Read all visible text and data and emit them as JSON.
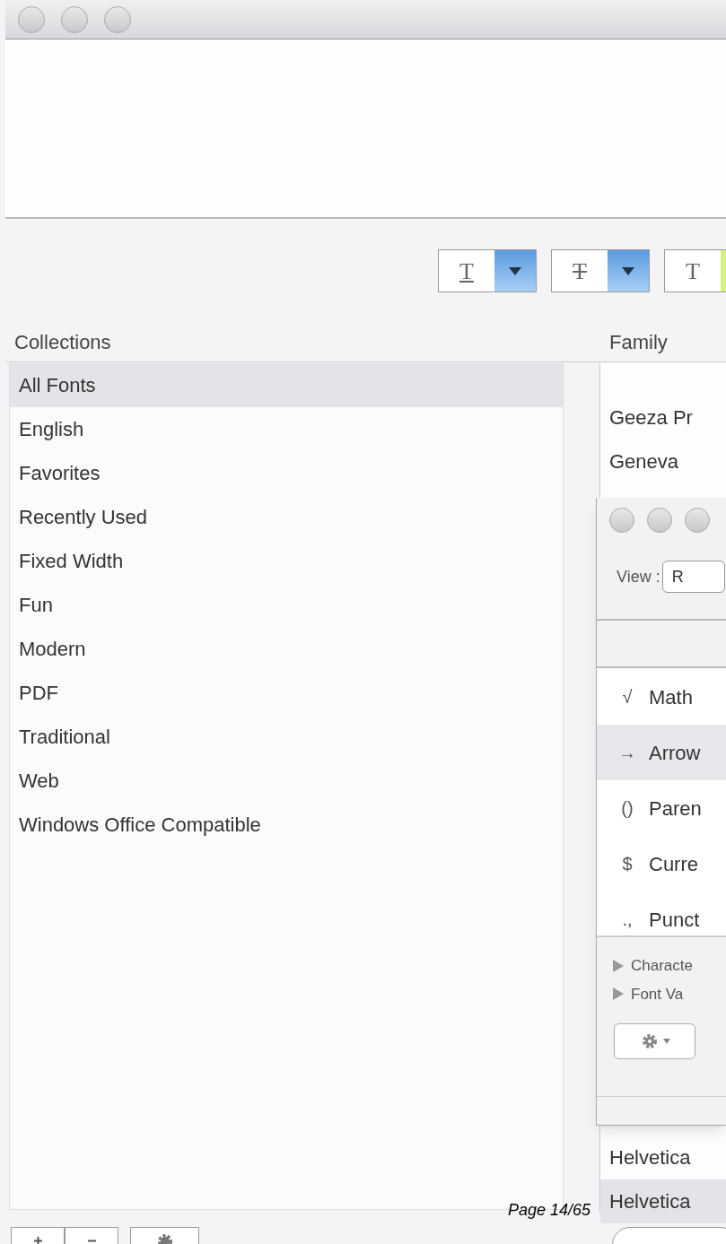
{
  "toolbar": {
    "buttons": [
      {
        "kind": "underline",
        "glyph": "T"
      },
      {
        "kind": "strike",
        "glyph": "T"
      },
      {
        "kind": "color",
        "glyph": "T"
      }
    ]
  },
  "collections": {
    "header": "Collections",
    "items": [
      {
        "label": "All Fonts",
        "selected": true
      },
      {
        "label": "English",
        "selected": false
      },
      {
        "label": "Favorites",
        "selected": false
      },
      {
        "label": "Recently Used",
        "selected": false
      },
      {
        "label": "Fixed Width",
        "selected": false
      },
      {
        "label": "Fun",
        "selected": false
      },
      {
        "label": "Modern",
        "selected": false
      },
      {
        "label": "PDF",
        "selected": false
      },
      {
        "label": "Traditional",
        "selected": false
      },
      {
        "label": "Web",
        "selected": false
      },
      {
        "label": "Windows Office Compatible",
        "selected": false
      }
    ]
  },
  "family": {
    "header": "Family",
    "items_top": [
      {
        "label": "Geeza Pr",
        "selected": false
      },
      {
        "label": "Geneva",
        "selected": false
      }
    ],
    "items_bottom": [
      {
        "label": "Helvetica",
        "selected": false
      },
      {
        "label": "Helvetica",
        "selected": true
      }
    ]
  },
  "character_palette": {
    "view_label": "View :",
    "view_value": "R",
    "items": [
      {
        "symbol": "√",
        "label": "Math",
        "selected": false
      },
      {
        "symbol": "→",
        "label": "Arrow",
        "selected": true
      },
      {
        "symbol": "()",
        "label": "Paren",
        "selected": false
      },
      {
        "symbol": "$",
        "label": "Curre",
        "selected": false
      },
      {
        "symbol": ".,",
        "label": "Punct",
        "selected": false
      }
    ],
    "disclosures": [
      {
        "label": "Characte",
        "expanded": false
      },
      {
        "label": "Font Va",
        "expanded": false
      }
    ]
  },
  "bottom_buttons": [
    {
      "kind": "plus"
    },
    {
      "kind": "minus"
    }
  ],
  "page_label": "Page 14/65"
}
